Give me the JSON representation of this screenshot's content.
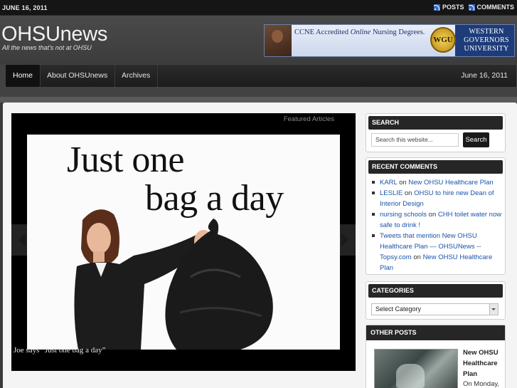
{
  "topbar": {
    "date": "JUNE 16, 2011",
    "posts_label": "POSTS",
    "comments_label": "COMMENTS",
    "feed_icon": "rss-icon"
  },
  "header": {
    "title": "OHSUnews",
    "tagline": "All the news that's not at OHSU"
  },
  "ad": {
    "headline_prefix": "CCNE Accredited ",
    "headline_italic": "Online",
    "headline_suffix": " Nursing Degrees.",
    "seal_text": "WGU",
    "university_line1": "WESTERN",
    "university_line2": "GOVERNORS",
    "university_line3": "UNIVERSITY"
  },
  "nav": {
    "items": [
      {
        "label": "Home"
      },
      {
        "label": "About OHSUnews"
      },
      {
        "label": "Archives"
      }
    ],
    "date": "June 16, 2011"
  },
  "featured": {
    "label": "Featured Articles",
    "slide_line1": "Just one",
    "slide_line2": "bag a day",
    "caption": "Joe says “Just one bag a day”"
  },
  "sidebar": {
    "search": {
      "heading": "SEARCH",
      "placeholder": "Search this website...",
      "button": "Search"
    },
    "recent_comments": {
      "heading": "RECENT COMMENTS",
      "items": [
        {
          "author": "KARL",
          "on": " on ",
          "post": "New OHSU Healthcare Plan"
        },
        {
          "author": "LESLIE",
          "on": " on ",
          "post": "OHSU to hire new Dean of Interior Design"
        },
        {
          "author": "nursing schools",
          "on": " on ",
          "post": "CHH toilet water now safe to drink !"
        },
        {
          "author": "Tweets that mention New OHSU Healthcare Plan — OHSUNews -- Topsy.com",
          "on": " on ",
          "post": "New OHSU Healthcare Plan"
        }
      ]
    },
    "categories": {
      "heading": "CATEGORIES",
      "selected": "Select Category"
    },
    "other_posts": {
      "heading": "OTHER POSTS",
      "post_title": "New OHSU Healthcare Plan",
      "excerpt": "On Monday,"
    }
  },
  "colors": {
    "link": "#1a54a8",
    "header_bg": "#424242",
    "widget_head": "#262626"
  }
}
